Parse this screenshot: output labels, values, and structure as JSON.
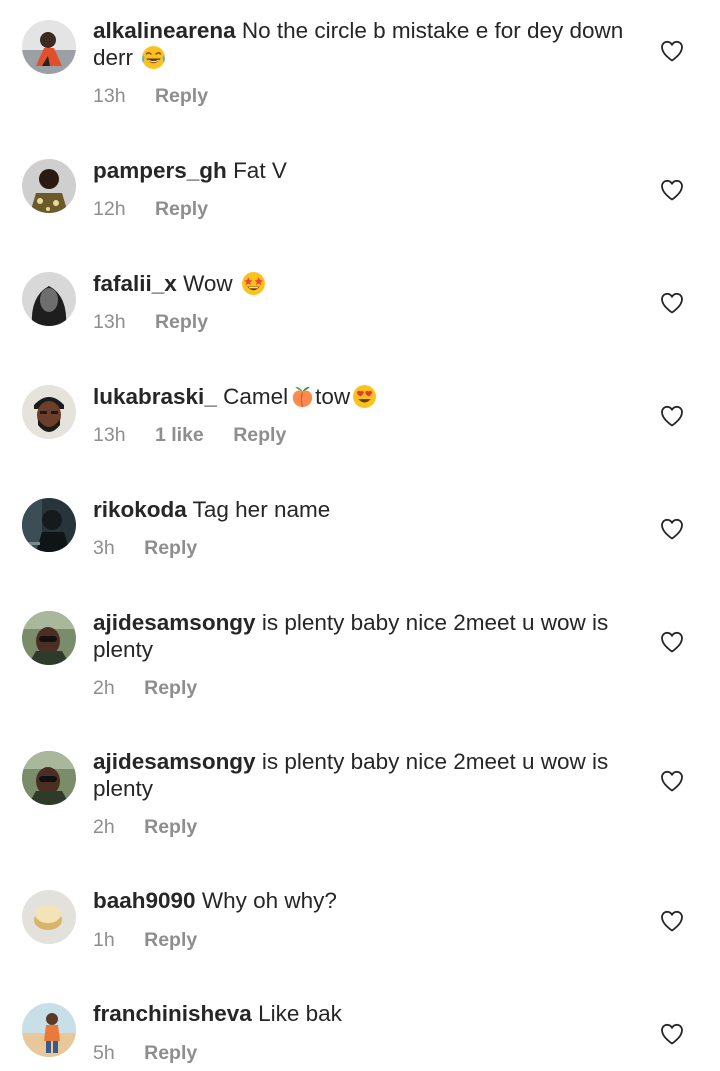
{
  "comments": [
    {
      "username": "alkalinearena",
      "text": "No the circle b mistake e for dey down derr",
      "emoji": "face-with-tears-of-joy",
      "time": "13h",
      "likes": "",
      "reply": "Reply"
    },
    {
      "username": "pampers_gh",
      "text": "Fat V",
      "time": "12h",
      "likes": "",
      "reply": "Reply"
    },
    {
      "username": "fafalii_x",
      "text": "Wow",
      "emoji": "star-struck",
      "time": "13h",
      "likes": "",
      "reply": "Reply"
    },
    {
      "username": "lukabraski_",
      "text_part1": "Camel",
      "emoji1": "peach",
      "text_part2": "tow",
      "emoji2": "heart-eyes",
      "time": "13h",
      "likes": "1 like",
      "reply": "Reply"
    },
    {
      "username": "rikokoda",
      "text": "Tag her name",
      "time": "3h",
      "likes": "",
      "reply": "Reply"
    },
    {
      "username": "ajidesamsongy",
      "text": "is plenty baby nice 2meet u wow is plenty",
      "time": "2h",
      "likes": "",
      "reply": "Reply"
    },
    {
      "username": "ajidesamsongy",
      "text": "is plenty baby nice 2meet u wow is plenty",
      "time": "2h",
      "likes": "",
      "reply": "Reply"
    },
    {
      "username": "baah9090",
      "text": "Why oh why?",
      "time": "1h",
      "likes": "",
      "reply": "Reply"
    },
    {
      "username": "franchinisheva",
      "text": "Like bak",
      "time": "5h",
      "likes": "",
      "reply": "Reply"
    }
  ],
  "icons": {
    "like": "heart-outline-icon"
  },
  "colors": {
    "text": "#262626",
    "meta": "#8e8e8e",
    "background": "#ffffff"
  }
}
